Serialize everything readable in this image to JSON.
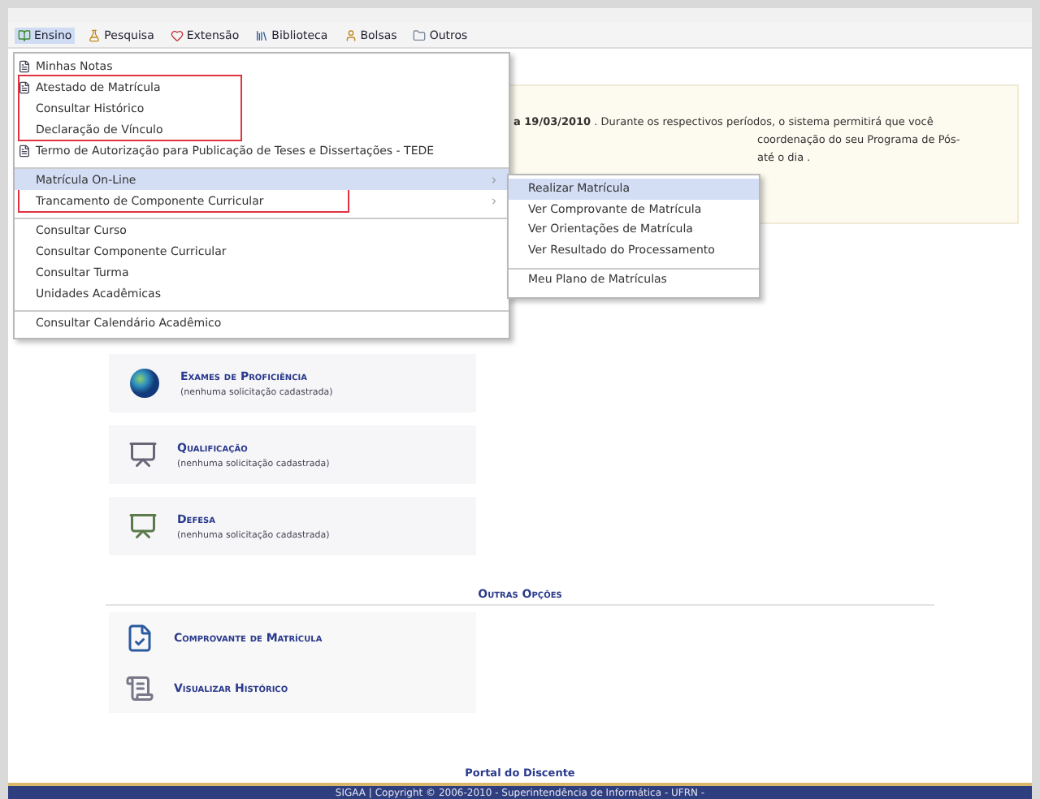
{
  "menu_bar": {
    "items": [
      {
        "label": "Ensino",
        "selected": true
      },
      {
        "label": "Pesquisa",
        "selected": false
      },
      {
        "label": "Extensão",
        "selected": false
      },
      {
        "label": "Biblioteca",
        "selected": false
      },
      {
        "label": "Bolsas",
        "selected": false
      },
      {
        "label": "Outros",
        "selected": false
      }
    ]
  },
  "dropdown": {
    "sections": [
      {
        "divider": false,
        "highlighted": false,
        "items": [
          {
            "label": "Minhas Notas",
            "icon": true,
            "submenu": false,
            "selected": false
          }
        ]
      },
      {
        "divider": false,
        "highlighted": true,
        "items": [
          {
            "label": "Atestado de Matrícula",
            "icon": true,
            "submenu": false,
            "selected": false
          },
          {
            "label": "Consultar Histórico",
            "icon": false,
            "submenu": false,
            "selected": false
          },
          {
            "label": "Declaração de Vínculo",
            "icon": false,
            "submenu": false,
            "selected": false
          }
        ]
      },
      {
        "divider": false,
        "highlighted": false,
        "items": [
          {
            "label": "Termo de Autorização para Publicação de Teses e Dissertações - TEDE",
            "icon": true,
            "submenu": false,
            "selected": false
          }
        ]
      },
      {
        "divider": true,
        "highlighted": true,
        "items": [
          {
            "label": "Matrícula On-Line",
            "icon": false,
            "submenu": true,
            "selected": true
          },
          {
            "label": "Trancamento de Componente Curricular",
            "icon": false,
            "submenu": true,
            "selected": false
          }
        ]
      },
      {
        "divider": true,
        "highlighted": false,
        "items": [
          {
            "label": "Consultar Curso",
            "icon": false,
            "submenu": false,
            "selected": false
          },
          {
            "label": "Consultar Componente Curricular",
            "icon": false,
            "submenu": false,
            "selected": false
          },
          {
            "label": "Consultar Turma",
            "icon": false,
            "submenu": false,
            "selected": false
          },
          {
            "label": "Unidades Acadêmicas",
            "icon": false,
            "submenu": false,
            "selected": false
          }
        ]
      },
      {
        "divider": true,
        "highlighted": false,
        "items": [
          {
            "label": "Consultar Calendário Acadêmico",
            "icon": false,
            "submenu": false,
            "selected": false
          }
        ]
      }
    ]
  },
  "submenu": {
    "items": [
      {
        "label": "Realizar Matrícula",
        "selected": true,
        "divider": false
      },
      {
        "label": "Ver Comprovante de Matrícula",
        "selected": false,
        "divider": false
      },
      {
        "label": "Ver Orientações de Matrícula",
        "selected": false,
        "divider": false
      },
      {
        "label": "Ver Resultado do Processamento",
        "selected": false,
        "divider": false
      },
      {
        "label": "Meu Plano de Matrículas",
        "selected": false,
        "divider": true
      }
    ]
  },
  "notice": {
    "lines": [
      "**a 19/03/2010** . Durante os respectivos períodos, o sistema permitirá que você",
      "coordenação do seu Programa de Pós-",
      "até o dia ."
    ]
  },
  "requests": [
    {
      "title": "Exames de Proficiência",
      "subtitle": "(nenhuma solicitação cadastrada)"
    },
    {
      "title": "Qualificação",
      "subtitle": "(nenhuma solicitação cadastrada)"
    },
    {
      "title": "Defesa",
      "subtitle": "(nenhuma solicitação cadastrada)"
    }
  ],
  "other_options": {
    "heading": "Outras Opções",
    "items": [
      {
        "title": "Comprovante de Matrícula"
      },
      {
        "title": "Visualizar Histórico"
      }
    ]
  },
  "footer": {
    "portal": "Portal do Discente",
    "copyright": "SIGAA | Copyright © 2006-2010 - Superintendência de Informática - UFRN -"
  }
}
